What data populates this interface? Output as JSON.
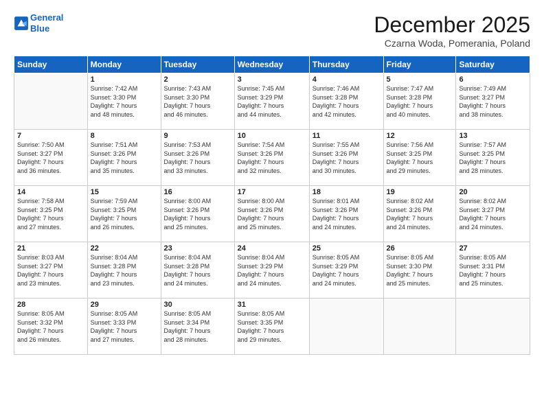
{
  "logo": {
    "line1": "General",
    "line2": "Blue"
  },
  "title": "December 2025",
  "subtitle": "Czarna Woda, Pomerania, Poland",
  "weekdays": [
    "Sunday",
    "Monday",
    "Tuesday",
    "Wednesday",
    "Thursday",
    "Friday",
    "Saturday"
  ],
  "weeks": [
    [
      {
        "day": "",
        "info": ""
      },
      {
        "day": "1",
        "info": "Sunrise: 7:42 AM\nSunset: 3:30 PM\nDaylight: 7 hours\nand 48 minutes."
      },
      {
        "day": "2",
        "info": "Sunrise: 7:43 AM\nSunset: 3:30 PM\nDaylight: 7 hours\nand 46 minutes."
      },
      {
        "day": "3",
        "info": "Sunrise: 7:45 AM\nSunset: 3:29 PM\nDaylight: 7 hours\nand 44 minutes."
      },
      {
        "day": "4",
        "info": "Sunrise: 7:46 AM\nSunset: 3:28 PM\nDaylight: 7 hours\nand 42 minutes."
      },
      {
        "day": "5",
        "info": "Sunrise: 7:47 AM\nSunset: 3:28 PM\nDaylight: 7 hours\nand 40 minutes."
      },
      {
        "day": "6",
        "info": "Sunrise: 7:49 AM\nSunset: 3:27 PM\nDaylight: 7 hours\nand 38 minutes."
      }
    ],
    [
      {
        "day": "7",
        "info": "Sunrise: 7:50 AM\nSunset: 3:27 PM\nDaylight: 7 hours\nand 36 minutes."
      },
      {
        "day": "8",
        "info": "Sunrise: 7:51 AM\nSunset: 3:26 PM\nDaylight: 7 hours\nand 35 minutes."
      },
      {
        "day": "9",
        "info": "Sunrise: 7:53 AM\nSunset: 3:26 PM\nDaylight: 7 hours\nand 33 minutes."
      },
      {
        "day": "10",
        "info": "Sunrise: 7:54 AM\nSunset: 3:26 PM\nDaylight: 7 hours\nand 32 minutes."
      },
      {
        "day": "11",
        "info": "Sunrise: 7:55 AM\nSunset: 3:26 PM\nDaylight: 7 hours\nand 30 minutes."
      },
      {
        "day": "12",
        "info": "Sunrise: 7:56 AM\nSunset: 3:25 PM\nDaylight: 7 hours\nand 29 minutes."
      },
      {
        "day": "13",
        "info": "Sunrise: 7:57 AM\nSunset: 3:25 PM\nDaylight: 7 hours\nand 28 minutes."
      }
    ],
    [
      {
        "day": "14",
        "info": "Sunrise: 7:58 AM\nSunset: 3:25 PM\nDaylight: 7 hours\nand 27 minutes."
      },
      {
        "day": "15",
        "info": "Sunrise: 7:59 AM\nSunset: 3:25 PM\nDaylight: 7 hours\nand 26 minutes."
      },
      {
        "day": "16",
        "info": "Sunrise: 8:00 AM\nSunset: 3:26 PM\nDaylight: 7 hours\nand 25 minutes."
      },
      {
        "day": "17",
        "info": "Sunrise: 8:00 AM\nSunset: 3:26 PM\nDaylight: 7 hours\nand 25 minutes."
      },
      {
        "day": "18",
        "info": "Sunrise: 8:01 AM\nSunset: 3:26 PM\nDaylight: 7 hours\nand 24 minutes."
      },
      {
        "day": "19",
        "info": "Sunrise: 8:02 AM\nSunset: 3:26 PM\nDaylight: 7 hours\nand 24 minutes."
      },
      {
        "day": "20",
        "info": "Sunrise: 8:02 AM\nSunset: 3:27 PM\nDaylight: 7 hours\nand 24 minutes."
      }
    ],
    [
      {
        "day": "21",
        "info": "Sunrise: 8:03 AM\nSunset: 3:27 PM\nDaylight: 7 hours\nand 23 minutes."
      },
      {
        "day": "22",
        "info": "Sunrise: 8:04 AM\nSunset: 3:28 PM\nDaylight: 7 hours\nand 23 minutes."
      },
      {
        "day": "23",
        "info": "Sunrise: 8:04 AM\nSunset: 3:28 PM\nDaylight: 7 hours\nand 24 minutes."
      },
      {
        "day": "24",
        "info": "Sunrise: 8:04 AM\nSunset: 3:29 PM\nDaylight: 7 hours\nand 24 minutes."
      },
      {
        "day": "25",
        "info": "Sunrise: 8:05 AM\nSunset: 3:29 PM\nDaylight: 7 hours\nand 24 minutes."
      },
      {
        "day": "26",
        "info": "Sunrise: 8:05 AM\nSunset: 3:30 PM\nDaylight: 7 hours\nand 25 minutes."
      },
      {
        "day": "27",
        "info": "Sunrise: 8:05 AM\nSunset: 3:31 PM\nDaylight: 7 hours\nand 25 minutes."
      }
    ],
    [
      {
        "day": "28",
        "info": "Sunrise: 8:05 AM\nSunset: 3:32 PM\nDaylight: 7 hours\nand 26 minutes."
      },
      {
        "day": "29",
        "info": "Sunrise: 8:05 AM\nSunset: 3:33 PM\nDaylight: 7 hours\nand 27 minutes."
      },
      {
        "day": "30",
        "info": "Sunrise: 8:05 AM\nSunset: 3:34 PM\nDaylight: 7 hours\nand 28 minutes."
      },
      {
        "day": "31",
        "info": "Sunrise: 8:05 AM\nSunset: 3:35 PM\nDaylight: 7 hours\nand 29 minutes."
      },
      {
        "day": "",
        "info": ""
      },
      {
        "day": "",
        "info": ""
      },
      {
        "day": "",
        "info": ""
      }
    ]
  ]
}
